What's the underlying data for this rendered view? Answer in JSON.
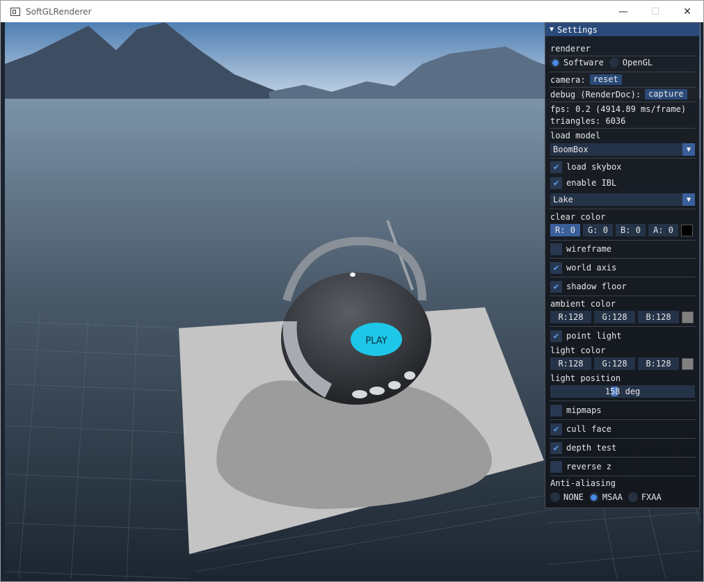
{
  "window": {
    "title": "SoftGLRenderer"
  },
  "scene": {
    "play_label": "PLAY"
  },
  "settings": {
    "title": "Settings",
    "renderer": {
      "label": "renderer",
      "options": [
        "Software",
        "OpenGL"
      ],
      "selected": "Software"
    },
    "camera": {
      "label": "camera:",
      "button": "reset"
    },
    "debug": {
      "label": "debug (RenderDoc):",
      "button": "capture"
    },
    "fps": "fps: 0.2 (4914.89 ms/frame)",
    "triangles": "triangles: 6036",
    "load_model": {
      "label": "load model",
      "selected": "BoomBox"
    },
    "load_skybox": {
      "label": "load skybox",
      "checked": true
    },
    "enable_ibl": {
      "label": "enable IBL",
      "checked": true
    },
    "skybox": {
      "selected": "Lake"
    },
    "clear_color": {
      "label": "clear color",
      "r": "R:  0",
      "g": "G:  0",
      "b": "B:  0",
      "a": "A:  0",
      "swatch": "#000000"
    },
    "wireframe": {
      "label": "wireframe",
      "checked": false
    },
    "world_axis": {
      "label": "world axis",
      "checked": true
    },
    "shadow_floor": {
      "label": "shadow floor",
      "checked": true
    },
    "ambient_color": {
      "label": "ambient color",
      "r": "R:128",
      "g": "G:128",
      "b": "B:128",
      "swatch": "#808080"
    },
    "point_light": {
      "label": "point light",
      "checked": true
    },
    "light_color": {
      "label": "light color",
      "r": "R:128",
      "g": "G:128",
      "b": "B:128",
      "swatch": "#808080"
    },
    "light_position": {
      "label": "light position",
      "value": "158 deg"
    },
    "mipmaps": {
      "label": "mipmaps",
      "checked": false
    },
    "cull_face": {
      "label": "cull face",
      "checked": true
    },
    "depth_test": {
      "label": "depth test",
      "checked": true
    },
    "reverse_z": {
      "label": "reverse z",
      "checked": false
    },
    "anti_aliasing": {
      "label": "Anti-aliasing",
      "options": [
        "NONE",
        "MSAA",
        "FXAA"
      ],
      "selected": "MSAA"
    }
  },
  "icons": {
    "checkmark": "✔",
    "dropdown": "▼",
    "collapse": "▼",
    "minimize": "—",
    "maximize": "☐",
    "close": "✕"
  },
  "colors": {
    "accent": "#4a8ae6",
    "button": "#2a4a78",
    "header": "#294a7a",
    "play_button": "#1ec7e8"
  }
}
